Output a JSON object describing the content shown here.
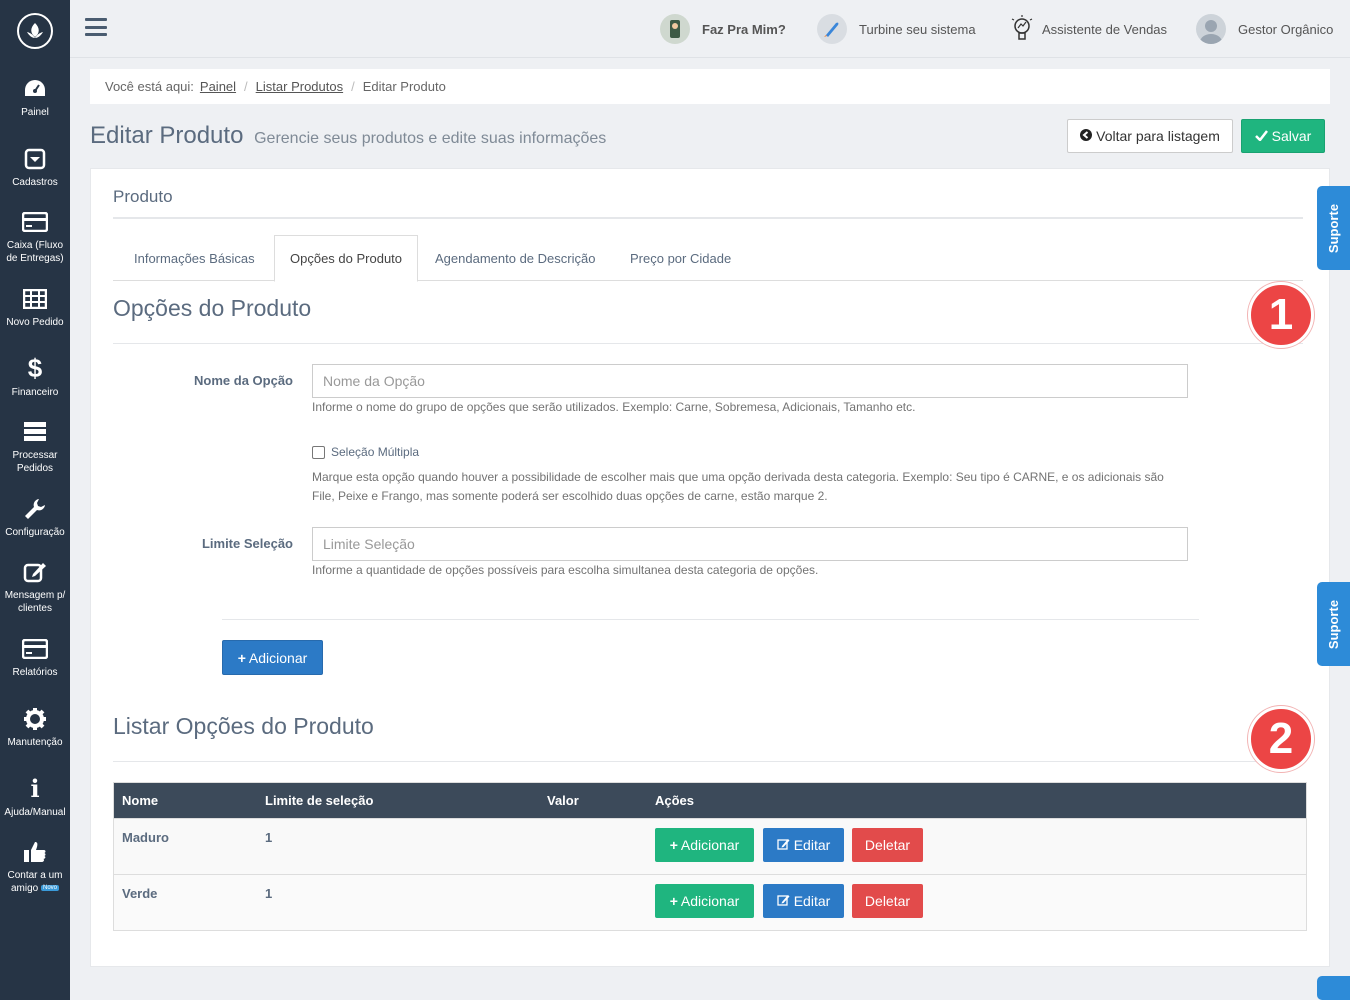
{
  "sidebar": {
    "items": [
      {
        "label": "Painel",
        "icon": "dashboard-icon"
      },
      {
        "label": "Cadastros",
        "icon": "box-icon"
      },
      {
        "label": "Caixa (Fluxo de Entregas)",
        "icon": "card-icon"
      },
      {
        "label": "Novo Pedido",
        "icon": "grid-icon"
      },
      {
        "label": "Financeiro",
        "icon": "dollar-icon"
      },
      {
        "label": "Processar Pedidos",
        "icon": "server-icon"
      },
      {
        "label": "Configuração",
        "icon": "wrench-icon"
      },
      {
        "label": "Mensagem p/ clientes",
        "icon": "edit-icon"
      },
      {
        "label": "Relatórios",
        "icon": "card-icon"
      },
      {
        "label": "Manutenção",
        "icon": "cog-icon"
      },
      {
        "label": "Ajuda/Manual",
        "icon": "info-icon"
      },
      {
        "label": "Contar a um amigo",
        "icon": "thumbs-up-icon",
        "badge": "Novo"
      }
    ]
  },
  "topbar": {
    "faz_pra_mim": "Faz Pra Mim?",
    "turbine": "Turbine seu sistema",
    "assistente": "Assistente de Vendas",
    "user": "Gestor Orgânico"
  },
  "breadcrumb": {
    "prefix": "Você está aqui:",
    "items": [
      "Painel",
      "Listar Produtos",
      "Editar Produto"
    ]
  },
  "page": {
    "title": "Editar Produto",
    "subtitle": "Gerencie seus produtos e edite suas informações",
    "back_label": "Voltar para listagem",
    "save_label": "Salvar"
  },
  "card": {
    "title": "Produto",
    "tabs": [
      "Informações Básicas",
      "Opções do Produto",
      "Agendamento de Descrição",
      "Preço por Cidade"
    ],
    "active_tab": "Opções do Produto"
  },
  "form": {
    "section_title": "Opções do Produto",
    "nome_label": "Nome da Opção",
    "nome_placeholder": "Nome da Opção",
    "nome_help": "Informe o nome do grupo de opções que serão utilizados. Exemplo: Carne, Sobremesa, Adicionais, Tamanho etc.",
    "multi_label": "Seleção Múltipla",
    "multi_help": "Marque esta opção quando houver a possibilidade de escolher mais que uma opção derivada desta categoria. Exemplo: Seu tipo é CARNE, e os adicionais são File, Peixe e Frango, mas somente poderá ser escolhido duas opções de carne, estão marque 2.",
    "limite_label": "Limite Seleção",
    "limite_placeholder": "Limite Seleção",
    "limite_help": "Informe a quantidade de opções possíveis para escolha simultanea desta categoria de opções.",
    "add_label": "Adicionar"
  },
  "list": {
    "section_title": "Listar Opções do Produto",
    "headers": [
      "Nome",
      "Limite de seleção",
      "Valor",
      "Ações"
    ],
    "rows": [
      {
        "nome": "Maduro",
        "limite": "1",
        "valor": ""
      },
      {
        "nome": "Verde",
        "limite": "1",
        "valor": ""
      }
    ],
    "actions": {
      "add": "Adicionar",
      "edit": "Editar",
      "delete": "Deletar"
    }
  },
  "markers": [
    "1",
    "2"
  ],
  "support_label": "Suporte",
  "colors": {
    "sidebar": "#263445",
    "success": "#1fb57f",
    "primary": "#2c7ac6",
    "danger": "#e24b4b",
    "marker": "#ec4545",
    "support": "#2d8bd8"
  }
}
